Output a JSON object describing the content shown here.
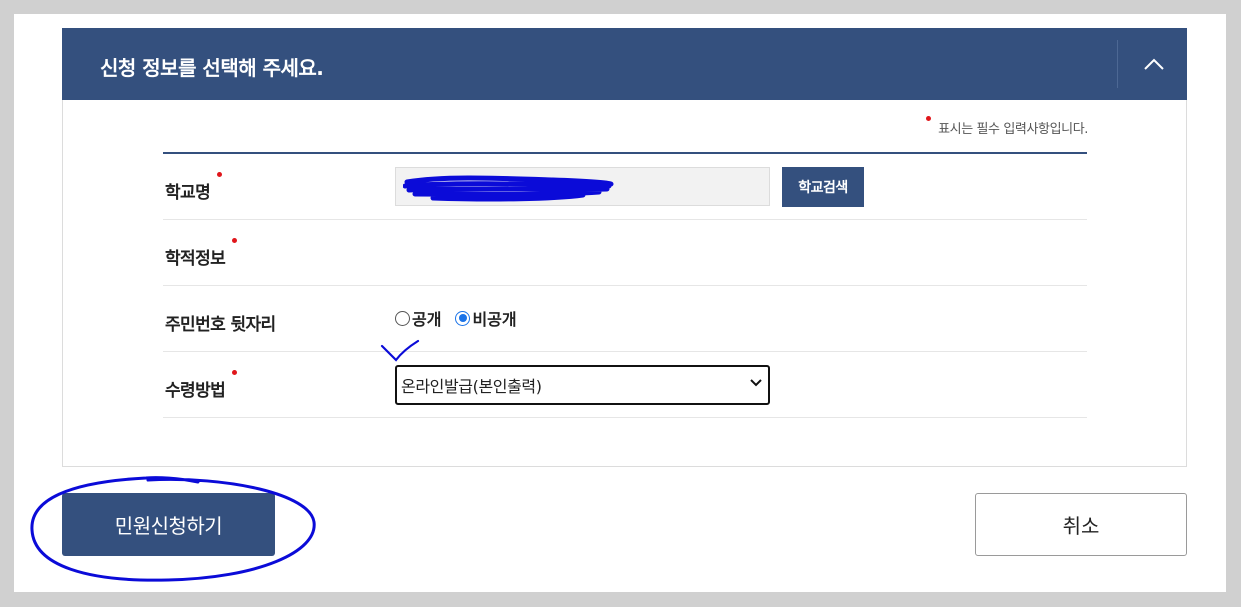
{
  "panel": {
    "title": "신청 정보를 선택해 주세요."
  },
  "required_note": "표시는 필수 입력사항입니다.",
  "form": {
    "school": {
      "label": "학교명",
      "value": "",
      "search_button": "학교검색"
    },
    "academic": {
      "label": "학적정보"
    },
    "resident_number": {
      "label": "주민번호 뒷자리",
      "options": [
        "공개",
        "비공개"
      ],
      "selected": "비공개"
    },
    "receive_method": {
      "label": "수령방법",
      "selected": "온라인발급(본인출력)"
    }
  },
  "actions": {
    "submit": "민원신청하기",
    "cancel": "취소"
  },
  "colors": {
    "primary": "#34507e",
    "required_dot": "#e0161b",
    "annotation": "#0b0bd8"
  }
}
